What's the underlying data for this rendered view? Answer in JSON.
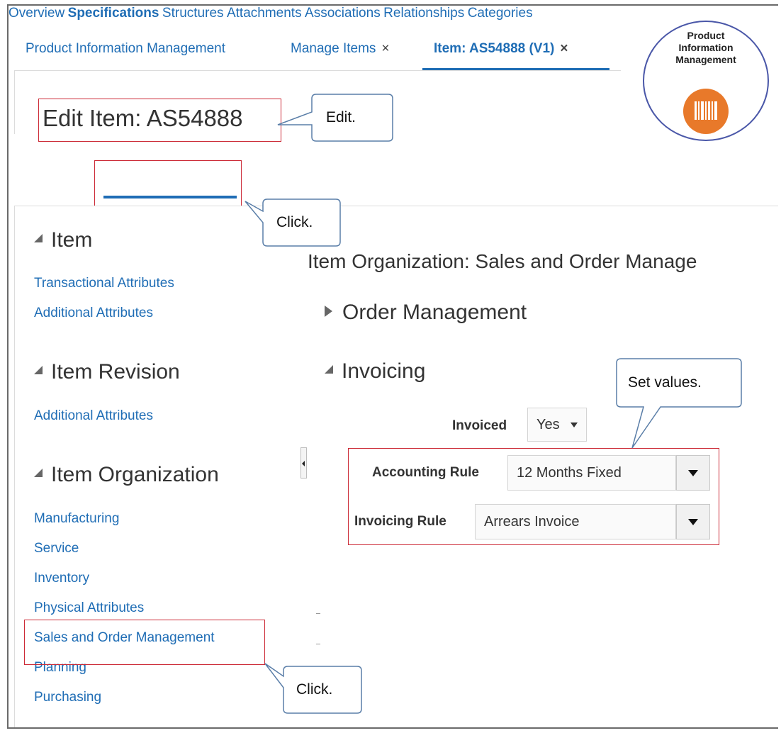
{
  "tabs": [
    {
      "label": "Product Information Management",
      "closable": false,
      "active": false
    },
    {
      "label": "Manage Items",
      "closable": true,
      "active": false
    },
    {
      "label": "Item: AS54888 (V1)",
      "closable": true,
      "active": true
    }
  ],
  "tab_close_symbol": "×",
  "badge": {
    "lines": [
      "Product",
      "Information",
      "Management"
    ],
    "icon": "barcode-icon",
    "color": "#e8792a"
  },
  "page_title": "Edit Item: AS54888",
  "subtabs": [
    "Overview",
    "Specifications",
    "Structures",
    "Attachments",
    "Associations",
    "Relationships",
    "Categories"
  ],
  "active_subtab": "Specifications",
  "sidebar": {
    "item": {
      "title": "Item",
      "links": [
        "Transactional Attributes",
        "Additional Attributes"
      ]
    },
    "item_revision": {
      "title": "Item Revision",
      "links": [
        "Additional Attributes"
      ]
    },
    "item_organization": {
      "title": "Item Organization",
      "links": [
        "Manufacturing",
        "Service",
        "Inventory",
        "Physical Attributes",
        "Sales and Order Management",
        "Planning",
        "Purchasing"
      ]
    }
  },
  "main": {
    "heading": "Item Organization: Sales and Order Manage",
    "order_management": "Order Management",
    "invoicing": "Invoicing",
    "fields": {
      "invoiced_label": "Invoiced",
      "invoiced_value": "Yes",
      "accounting_rule_label": "Accounting Rule",
      "accounting_rule_value": "12 Months Fixed",
      "invoicing_rule_label": "Invoicing Rule",
      "invoicing_rule_value": "Arrears Invoice"
    }
  },
  "callouts": {
    "edit": "Edit.",
    "click_tab": "Click.",
    "set_values": "Set values.",
    "click_link": "Click."
  },
  "colors": {
    "link": "#1f6db5",
    "highlight": "#cc2a36",
    "active_tab_underline": "#1f6db5",
    "badge_orange": "#e8792a"
  }
}
